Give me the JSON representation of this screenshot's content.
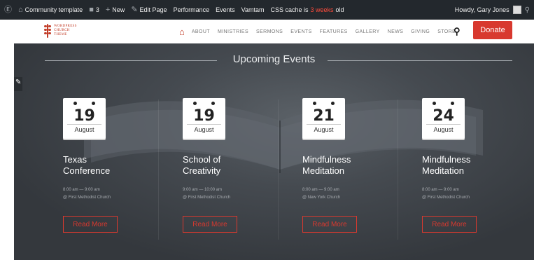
{
  "adminbar": {
    "site_name": "Community template",
    "comments_count": "3",
    "new_label": "New",
    "edit_label": "Edit Page",
    "performance_label": "Performance",
    "events_label": "Events",
    "vamtam_label": "Vamtam",
    "cache_prefix": "CSS cache is",
    "cache_age": "3 weeks",
    "cache_suffix": "old",
    "howdy": "Howdy, Gary Jones"
  },
  "logo": {
    "line1": "WORDPRESS",
    "line2": "CHURCH",
    "line3": "THEME"
  },
  "nav": {
    "items": [
      "ABOUT",
      "MINISTRIES",
      "SERMONS",
      "EVENTS",
      "FEATURES",
      "GALLERY",
      "NEWS",
      "GIVING",
      "STORE"
    ],
    "donate": "Donate"
  },
  "section": {
    "title": "Upcoming Events"
  },
  "events": [
    {
      "day": "19",
      "month": "August",
      "name_line1": "Texas",
      "name_line2": "Conference",
      "time": "8:00 am — 9:00 am",
      "location": "@ First Methodist Church",
      "button": "Read More"
    },
    {
      "day": "19",
      "month": "August",
      "name_line1": "School of",
      "name_line2": "Creativity",
      "time": "9:00 am — 10:00 am",
      "location": "@ First Methodist Church",
      "button": "Read More"
    },
    {
      "day": "21",
      "month": "August",
      "name_line1": "Mindfulness",
      "name_line2": "Meditation",
      "time": "8:00 am — 9:00 am",
      "location": "@ New York Church",
      "button": "Read More"
    },
    {
      "day": "24",
      "month": "August",
      "name_line1": "Mindfulness",
      "name_line2": "Meditation",
      "time": "8:00 am — 9:00 am",
      "location": "@ First Methodist Church",
      "button": "Read More"
    }
  ],
  "colors": {
    "accent": "#d8392f",
    "adminbar": "#23282d",
    "hero": "#454a50"
  },
  "icons": [
    "wordpress-icon",
    "home-icon",
    "comment-icon",
    "plus-icon",
    "pencil-icon",
    "search-icon",
    "paintbrush-icon"
  ]
}
